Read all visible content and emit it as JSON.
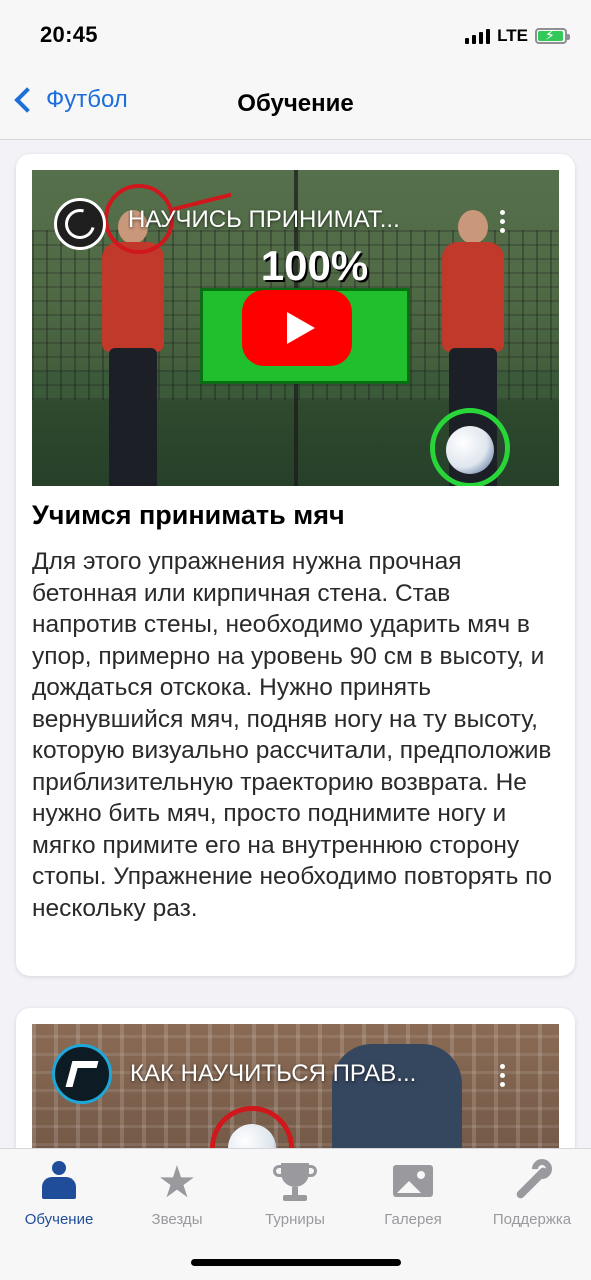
{
  "status_bar": {
    "time": "20:45",
    "network": "LTE"
  },
  "nav": {
    "back_label": "Футбол",
    "title": "Обучение"
  },
  "cards": [
    {
      "video_title": "НАУЧИСЬ ПРИНИМАТ...",
      "thumbnail_text": "100%",
      "title": "Учимся принимать мяч",
      "text": "Для этого упражнения нужна прочная бетонная или кирпичная стена. Став напротив стены, необходимо ударить мяч в упор, примерно на уровень 90 см в высоту, и дождаться отскока. Нужно принять вернувшийся мяч, подняв ногу на ту высоту, которую визуально рассчитали, предположив приблизительную траекторию возврата. Не нужно бить мяч, просто поднимите ногу и мягко примите его на внутреннюю сторону стопы. Упражнение необходимо повторять по нескольку раз."
    },
    {
      "video_title": "КАК НАУЧИТЬСЯ ПРАВ..."
    }
  ],
  "tab_bar": {
    "items": [
      {
        "label": "Обучение",
        "icon": "person-icon",
        "active": true
      },
      {
        "label": "Звезды",
        "icon": "star-icon",
        "active": false
      },
      {
        "label": "Турниры",
        "icon": "trophy-icon",
        "active": false
      },
      {
        "label": "Галерея",
        "icon": "gallery-icon",
        "active": false
      },
      {
        "label": "Поддержка",
        "icon": "wrench-icon",
        "active": false
      }
    ]
  },
  "colors": {
    "accent": "#1e6fd9",
    "active_tab": "#1f4d99",
    "inactive_tab": "#9a9a9e",
    "youtube_red": "#ff0000"
  }
}
